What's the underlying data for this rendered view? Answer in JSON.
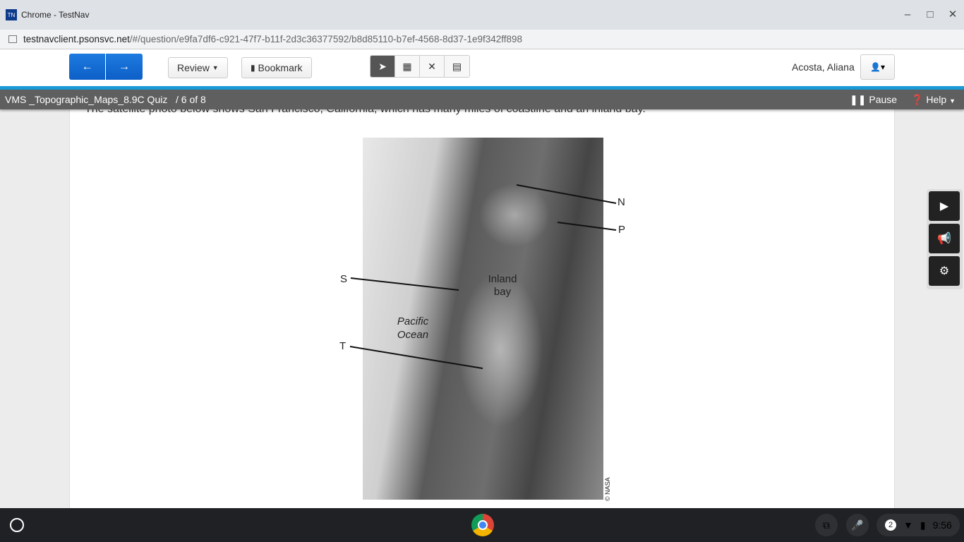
{
  "window": {
    "title": "Chrome - TestNav",
    "favicon": "TN"
  },
  "address": {
    "host": "testnavclient.psonsvc.net",
    "path": "/#/question/e9fa7df6-c921-47f7-b11f-2d3c36377592/b8d85110-b7ef-4568-8d37-1e9f342ff898"
  },
  "toolbar": {
    "review": "Review",
    "bookmark": "Bookmark",
    "user": "Acosta, Aliana"
  },
  "quiz": {
    "title": "VMS _Topographic_Maps_8.9C Quiz",
    "progress": "/  6 of 8",
    "pause": "Pause",
    "help": "Help"
  },
  "question": {
    "text": "The satellite photo below shows San Francisco, California, which has many miles of coastline and an inland bay."
  },
  "figure": {
    "labels": {
      "n": "N",
      "p": "P",
      "s": "S",
      "t": "T",
      "bay": "Inland bay",
      "ocean": "Pacific Ocean",
      "credit": "© NASA"
    }
  },
  "taskbar": {
    "notifications": "2",
    "time": "9:56"
  }
}
